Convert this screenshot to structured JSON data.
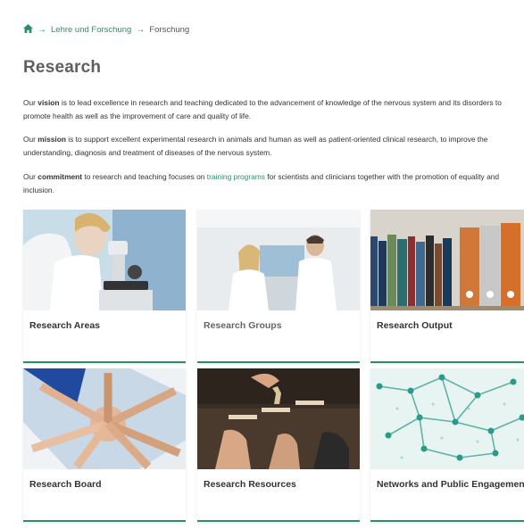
{
  "breadcrumb": {
    "home_icon": "home-icon",
    "items": [
      "Lehre und Forschung",
      "Forschung"
    ],
    "accent": "#2f8d6a"
  },
  "page_title": "Research",
  "paragraphs": {
    "vision": {
      "pre": "Our ",
      "bold": "vision",
      "post": " is to lead excellence in research and teaching dedicated to the advancement of knowledge of the nervous system and its disorders to promote health as well as the improvement of care and quality of life."
    },
    "mission": {
      "pre": "Our ",
      "bold": "mission",
      "post": " is to support excellent experimental research in animals and human as well as patient-oriented clinical research, to improve the understanding, diagnosis and treatment of diseases of the nervous system."
    },
    "commitment": {
      "pre": "Our ",
      "bold": "commitment",
      "mid": " to research and teaching focuses on ",
      "link": "training programs",
      "post": " for scientists and clinicians together with the promotion of equality and inclusion."
    }
  },
  "cards": [
    {
      "title": "Research Areas",
      "image": "microscope-photo"
    },
    {
      "title": "Research Groups",
      "image": "lab-researchers-photo"
    },
    {
      "title": "Research Output",
      "image": "binders-photo"
    },
    {
      "title": "Research Board",
      "image": "hands-together-photo"
    },
    {
      "title": "Research Resources",
      "image": "wooden-steps-photo"
    },
    {
      "title": "Networks and Public Engagement",
      "image": "network-graph-photo"
    }
  ]
}
